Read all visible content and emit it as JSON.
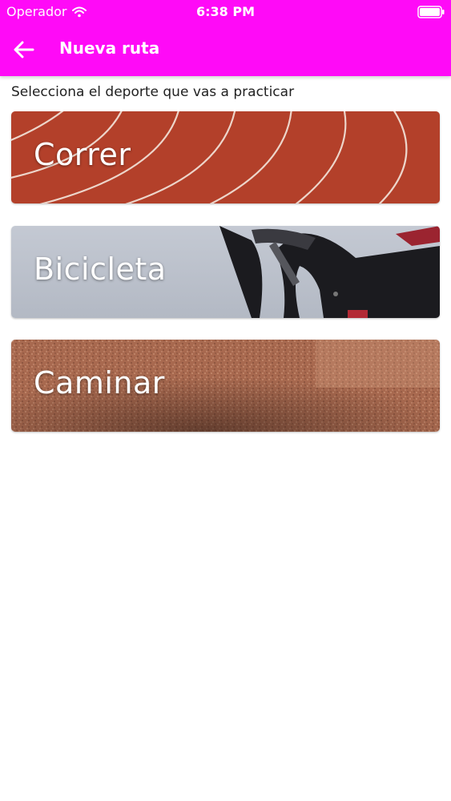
{
  "status_bar": {
    "carrier": "Operador",
    "time": "6:38 PM"
  },
  "nav": {
    "title": "Nueva ruta",
    "back_icon": "arrow-left-icon"
  },
  "prompt": "Selecciona el deporte que vas a practicar",
  "sports": [
    {
      "label": "Correr",
      "image": "running-track"
    },
    {
      "label": "Bicicleta",
      "image": "bicycle-handlebar"
    },
    {
      "label": "Caminar",
      "image": "sand-ground"
    }
  ],
  "colors": {
    "header": "#ff0af7",
    "track": "#b8432c",
    "sky": "#c7ccd5",
    "sand": "#a86a4f"
  }
}
